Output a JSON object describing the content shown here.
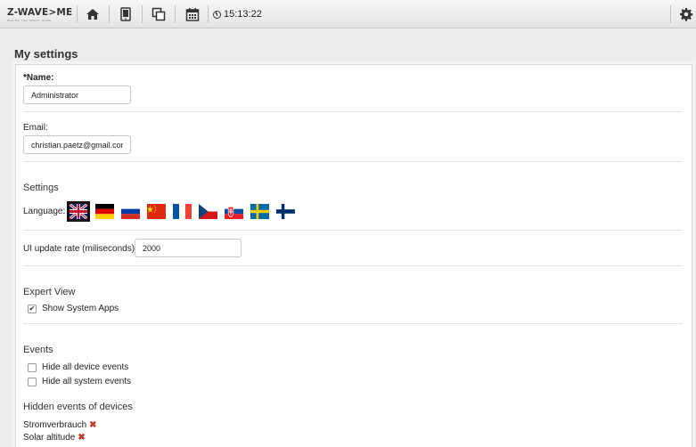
{
  "app": {
    "logo_text": "Z-WAVE>ME",
    "logo_tagline": "BEHIND THE SMART HOME",
    "time": "15:13:22"
  },
  "topbar": {
    "icons": [
      "home-icon",
      "tablet-icon",
      "copy-icon",
      "calendar-icon",
      "clock-icon",
      "gear-icon"
    ]
  },
  "page": {
    "title": "My settings"
  },
  "form": {
    "name_label": "*Name:",
    "name_value": "Administrator",
    "email_label": "Email:",
    "email_value": "christian.paetz@gmail.con",
    "settings_title": "Settings",
    "language_label": "Language:",
    "languages": [
      "English",
      "German",
      "Russian",
      "Chinese",
      "French",
      "Czech",
      "Slovak",
      "Swedish",
      "Finnish"
    ],
    "selected_language": "English",
    "rate_label": "UI update rate (miliseconds):",
    "rate_value": "2000",
    "expert_title": "Expert View",
    "show_system_apps_label": "Show System Apps",
    "show_system_apps_checked": true,
    "events_title": "Events",
    "hide_device_events_label": "Hide all device events",
    "hide_device_events_checked": false,
    "hide_system_events_label": "Hide all system events",
    "hide_system_events_checked": false,
    "hidden_devices_title": "Hidden events of devices",
    "hidden_devices": [
      "Stromverbrauch",
      "Solar altitude"
    ]
  },
  "colors": {
    "remove": "#c0392b",
    "selected_border": "#111111"
  }
}
